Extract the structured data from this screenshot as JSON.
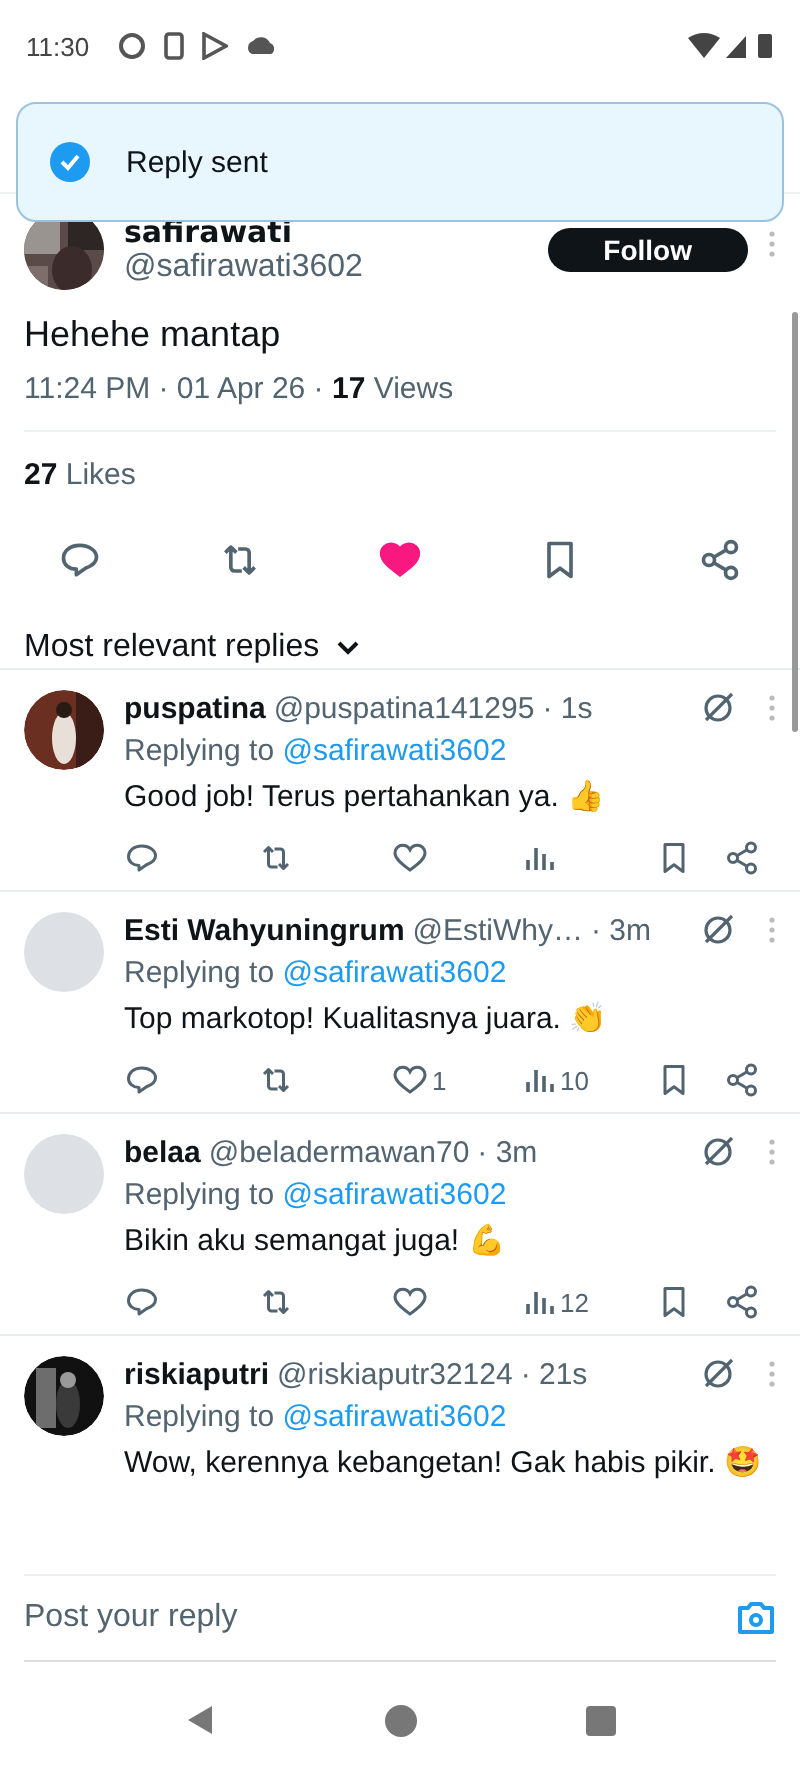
{
  "status_bar": {
    "time": "11:30"
  },
  "toast": {
    "text": "Reply sent"
  },
  "post": {
    "author": "safirawati",
    "handle": "@safirawati3602",
    "follow_label": "Follow",
    "text": "Hehehe mantap",
    "meta": "11:24 PM · 01 Apr 26 · **17** Views",
    "likes": "**27** Likes",
    "liked": true
  },
  "replies_sort": {
    "label": "Most relevant replies"
  },
  "replies": [
    {
      "name": "puspatina",
      "handle": "@puspatina141295",
      "time": "· 1s",
      "replying_prefix": "Replying to",
      "replying_handle": "@safirawati3602",
      "text": "Good job! Terus pertahankan ya. 👍",
      "liked": false
    },
    {
      "name": "Esti Wahyuningrum",
      "handle": "@EstiWhy…",
      "time": "· 3m",
      "avatar": {
        "kind": "placeholder"
      },
      "replying_prefix": "Replying to",
      "replying_handle": "@safirawati3602",
      "text": "Top markotop! Kualitasnya juara. 👏",
      "liked": false,
      "likes": "1",
      "views": "10"
    },
    {
      "name": "belaa",
      "handle": "@beladermawan70",
      "time": "· 3m",
      "avatar": {
        "kind": "placeholder"
      },
      "replying_prefix": "Replying to",
      "replying_handle": "@safirawati3602",
      "text": "Bikin aku semangat juga! 💪",
      "liked": false,
      "views": "12"
    },
    {
      "name": "riskiaputri",
      "handle": "@riskiaputr32124",
      "time": "· 21s",
      "replying_prefix": "Replying to",
      "replying_handle": "@safirawati3602",
      "text": "Wow, kerennya kebangetan! Gak habis pikir. 🤩",
      "cut": true
    }
  ],
  "composer": {
    "placeholder": "Post your reply"
  }
}
